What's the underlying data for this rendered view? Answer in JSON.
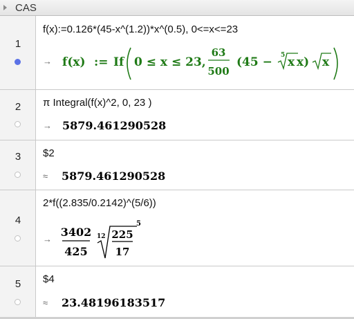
{
  "window": {
    "title": "CAS"
  },
  "rows": [
    {
      "number": "1",
      "input": "f(x):=0.126*(45-x^(1.2))*x^(0.5), 0<=x<=23",
      "output_prefix": "→",
      "output": {
        "fname": "f(x)",
        "assign": ":=",
        "keyword": "If",
        "condition": "0 ≤ x ≤ 23,",
        "frac_num": "63",
        "frac_den": "500",
        "expr_left": "(45 −",
        "root_index": "5",
        "root_radicand": "x",
        "expr_after_root": " x)",
        "sqrt_radicand": "x"
      }
    },
    {
      "number": "2",
      "input": "π Integral(f(x)^2, 0, 23 )",
      "output_prefix": "→",
      "output": "5879.461290528"
    },
    {
      "number": "3",
      "input": "$2",
      "output_prefix": "≈",
      "output": "5879.461290528"
    },
    {
      "number": "4",
      "input": "2*f((2.835/0.2142)^(5/6))",
      "output_prefix": "→",
      "output": {
        "frac_num": "3402",
        "frac_den": "425",
        "root_index": "12",
        "rad_num": "225",
        "rad_den": "17",
        "exponent": "5"
      }
    },
    {
      "number": "5",
      "input": "$4",
      "output_prefix": "≈",
      "output": "23.48196183517"
    }
  ],
  "colors": {
    "output_green": "#1f7a16",
    "active_dot": "#5b72e6"
  }
}
